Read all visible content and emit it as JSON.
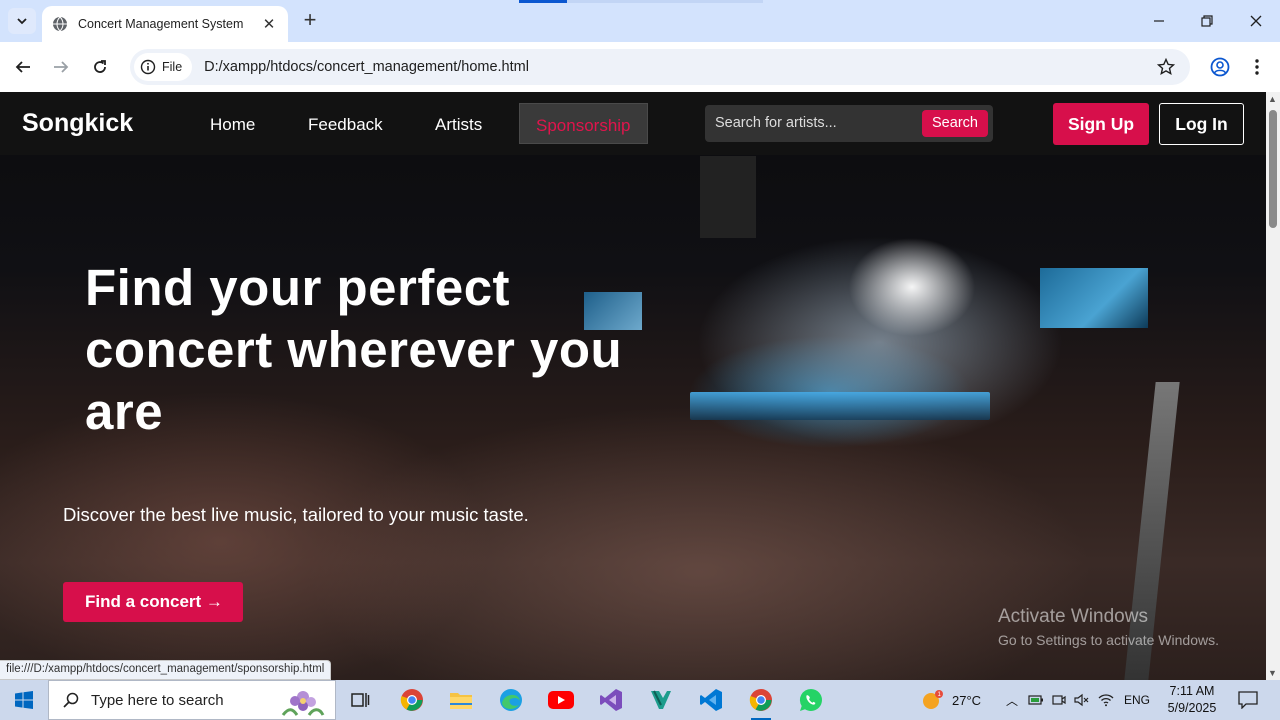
{
  "browser": {
    "tab_title": "Concert Management System",
    "chip_label": "File",
    "url": "D:/xampp/htdocs/concert_management/home.html",
    "status_url": "file:///D:/xampp/htdocs/concert_management/sponsorship.html"
  },
  "site": {
    "logo": "Songkick",
    "nav": {
      "home": "Home",
      "feedback": "Feedback",
      "artists": "Artists",
      "sponsorship": "Sponsorship"
    },
    "search": {
      "placeholder": "Search for artists...",
      "button": "Search"
    },
    "signup": "Sign Up",
    "login": "Log In",
    "accent_color": "#d70f4b"
  },
  "hero": {
    "headline": "Find your perfect concert wherever you are",
    "subline": "Discover the best live music, tailored to your music taste.",
    "cta": "Find a concert →"
  },
  "watermark": {
    "line1": "Activate Windows",
    "line2": "Go to Settings to activate Windows."
  },
  "taskbar": {
    "search_placeholder": "Type here to search",
    "weather": "27°C",
    "language": "ENG",
    "time": "7:11 AM",
    "date": "5/9/2025",
    "pinned_icons": [
      "task-view-icon",
      "chrome-icon",
      "file-explorer-icon",
      "edge-icon",
      "youtube-icon",
      "visual-studio-icon",
      "vscode-insiders-icon",
      "vscode-icon",
      "chrome-active-icon",
      "whatsapp-icon"
    ]
  }
}
